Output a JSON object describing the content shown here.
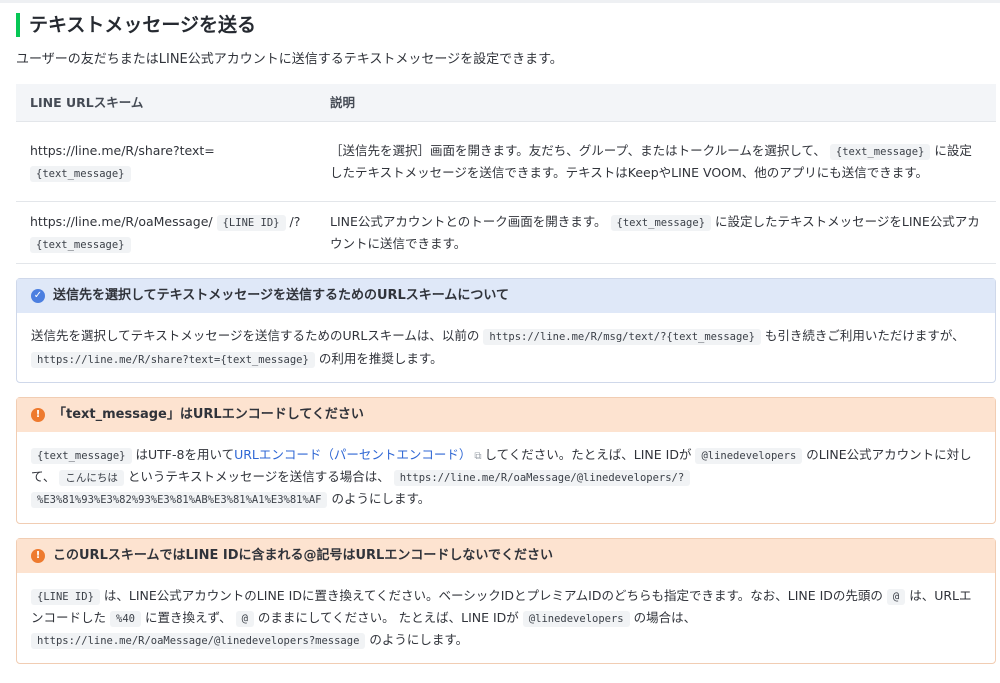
{
  "heading": "テキストメッセージを送る",
  "intro": "ユーザーの友だちまたはLINE公式アカウントに送信するテキストメッセージを設定できます。",
  "table": {
    "col1": "LINE URLスキーム",
    "col2": "説明",
    "row1": {
      "scheme_text": "https://line.me/R/share?text=",
      "scheme_code": "{text_message}",
      "desc_a": "［送信先を選択］画面を開きます。友だち、グループ、またはトークルームを選択して、",
      "desc_code": "{text_message}",
      "desc_b": "に設定したテキストメッセージを送信できます。テキストはKeepやLINE VOOM、他のアプリにも送信できます。"
    },
    "row2": {
      "scheme_text1": "https://line.me/R/oaMessage/",
      "scheme_code1": "{LINE ID}",
      "scheme_text2": "/?",
      "scheme_code2": "{text_message}",
      "desc_a": "LINE公式アカウントとのトーク画面を開きます。",
      "desc_code": "{text_message}",
      "desc_b": "に設定したテキストメッセージをLINE公式アカウントに送信できます。"
    }
  },
  "box1": {
    "icon": "check-circle-icon",
    "title": "送信先を選択してテキストメッセージを送信するためのURLスキームについて",
    "t1": "送信先を選択してテキストメッセージを送信するためのURLスキームは、以前の",
    "c1": "https://line.me/R/msg/text/?{text_message}",
    "t2": "も引き続きご利用いただけますが、",
    "c2": "https://line.me/R/share?text={text_message}",
    "t3": "の利用を推奨します。"
  },
  "box2": {
    "icon": "exclamation-circle-icon",
    "title": "「text_message」はURLエンコードしてください",
    "c1": "{text_message}",
    "t1": "はUTF-8を用いて",
    "link": "URLエンコード（パーセントエンコード）",
    "t2": "してください。たとえば、LINE IDが",
    "c2": "@linedevelopers",
    "t3": "のLINE公式アカウントに対して、",
    "c3": "こんにちは",
    "t4": "というテキストメッセージを送信する場合は、",
    "c4a": "https://line.me/R/oaMessage/@linedevelopers/?",
    "c4b": "%E3%81%93%E3%82%93%E3%81%AB%E3%81%A1%E3%81%AF",
    "t5": "のようにします。"
  },
  "box3": {
    "icon": "exclamation-circle-icon",
    "title": "このURLスキームではLINE IDに含まれる@記号はURLエンコードしないでください",
    "c1": "{LINE ID}",
    "t1": "は、LINE公式アカウントのLINE IDに置き換えてください。ベーシックIDとプレミアムIDのどちらも指定できます。なお、LINE IDの先頭の",
    "c2": "@",
    "t2": "は、URLエンコードした",
    "c3": "%40",
    "t3": "に置き換えず、",
    "c4": "@",
    "t4": "のままにしてください。 たとえば、LINE IDが",
    "c5": "@linedevelopers",
    "t5": "の場合は、",
    "c6": "https://line.me/R/oaMessage/@linedevelopers?message",
    "t6": "のようにします。"
  },
  "colors": {
    "accent": "#06c755",
    "info": "#4c7fe0",
    "warn": "#ee7a2e",
    "link": "#2f67d4"
  }
}
